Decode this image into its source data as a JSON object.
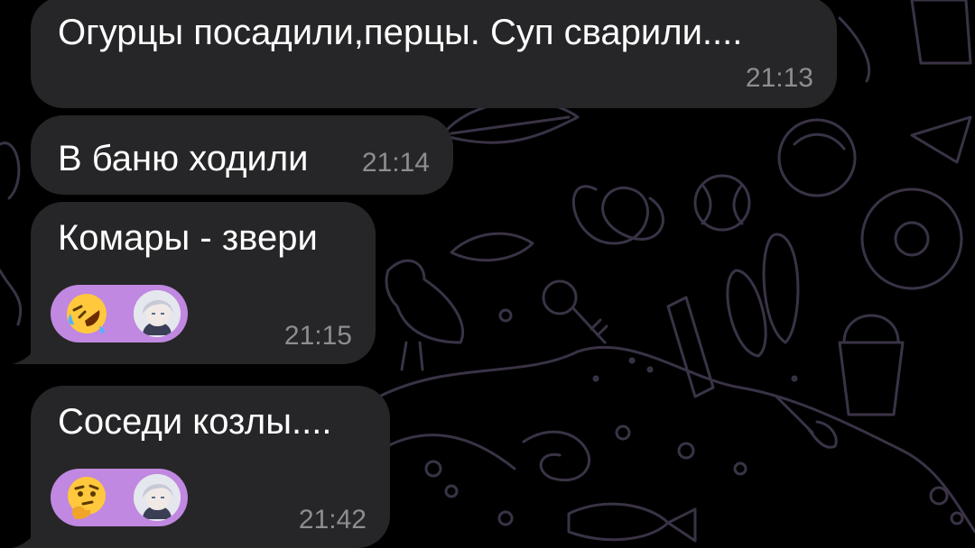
{
  "chat": {
    "messages": [
      {
        "text": "Огурцы посадили,перцы. Суп сварили....",
        "time": "21:13"
      },
      {
        "text": "В баню ходили",
        "time": "21:14"
      },
      {
        "text": "Комары - звери",
        "time": "21:15",
        "reaction_emoji": "rolling-on-floor-laughing",
        "reaction_color": "#c088e0"
      },
      {
        "text": "Соседи козлы....",
        "time": "21:42",
        "reaction_emoji": "thinking-face",
        "reaction_color": "#c088e0"
      }
    ]
  },
  "theme": {
    "background": "#000000",
    "bubble": "#262628",
    "time_color": "#8d8d92",
    "doodle_color": "#3a3346"
  }
}
